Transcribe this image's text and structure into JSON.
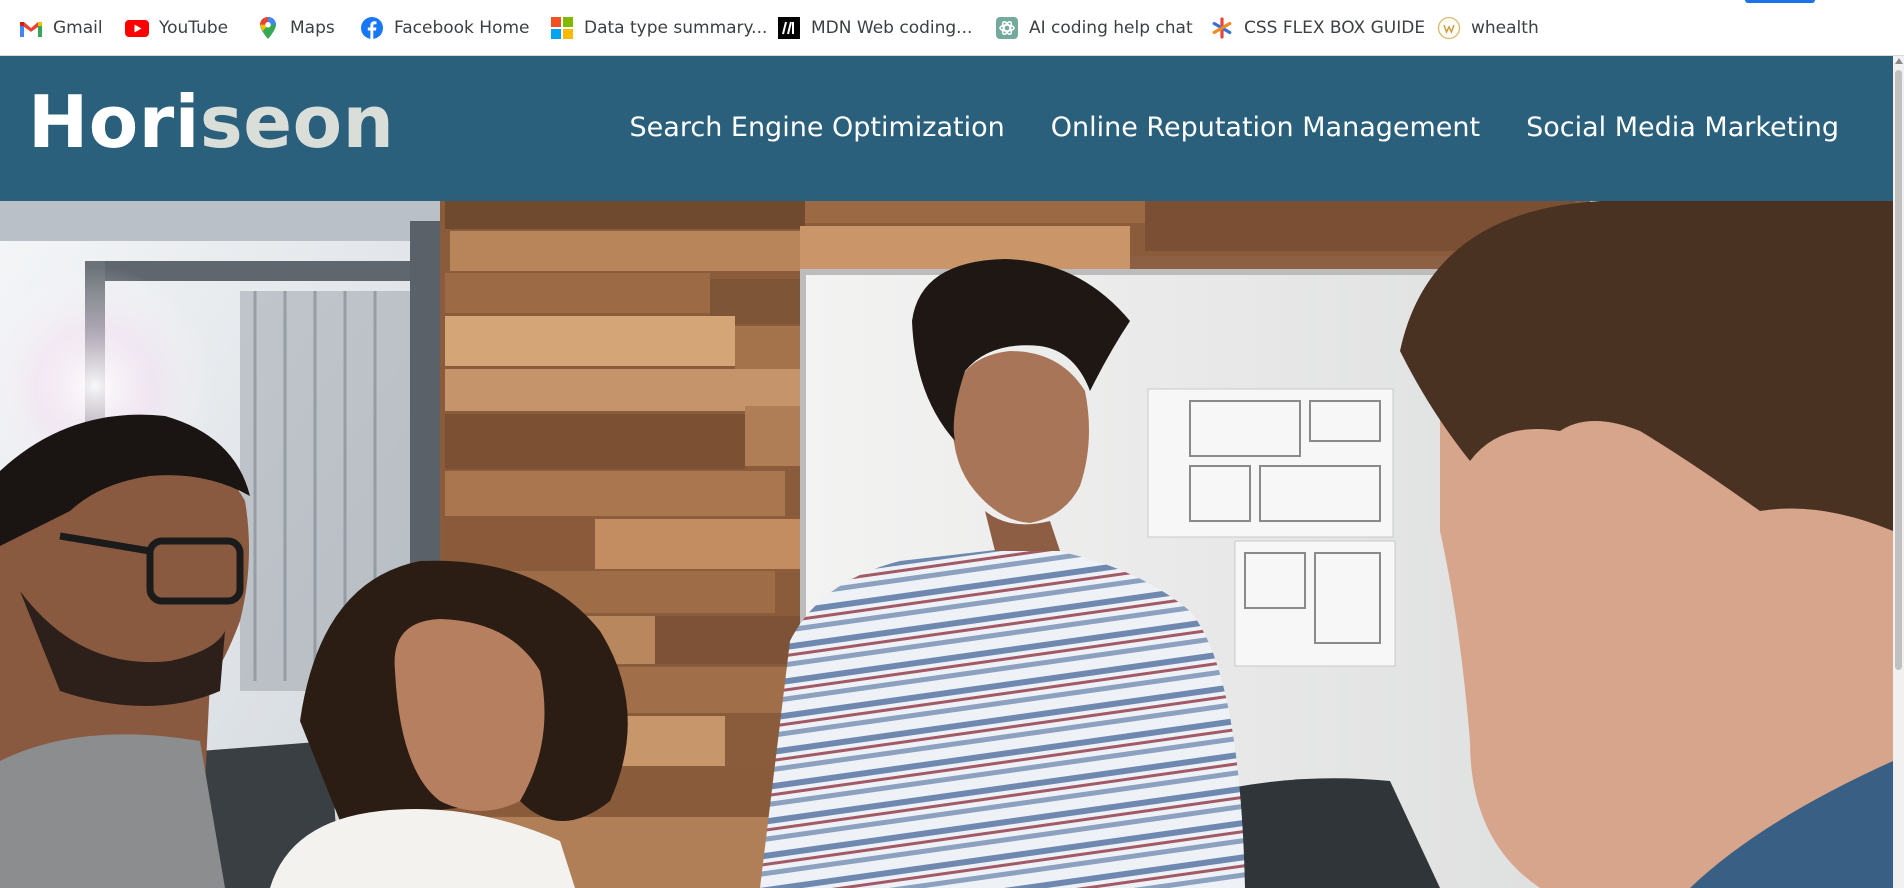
{
  "bookmarks": [
    {
      "label": "Gmail",
      "icon": "gmail-icon"
    },
    {
      "label": "YouTube",
      "icon": "youtube-icon"
    },
    {
      "label": "Maps",
      "icon": "maps-icon"
    },
    {
      "label": "Facebook Home",
      "icon": "facebook-icon"
    },
    {
      "label": "Data type summary...",
      "icon": "microsoft-icon"
    },
    {
      "label": "MDN Web coding...",
      "icon": "mdn-icon"
    },
    {
      "label": "AI coding help chat",
      "icon": "chatgpt-icon"
    },
    {
      "label": "CSS FLEX BOX GUIDE",
      "icon": "asterisk-icon"
    },
    {
      "label": "whealth",
      "icon": "whealth-icon"
    }
  ],
  "site": {
    "logo_main": "Hori",
    "logo_accent": "seon",
    "nav": [
      "Search Engine Optimization",
      "Online Reputation Management",
      "Social Media Marketing"
    ]
  },
  "colors": {
    "header_bg": "#2a607c",
    "logo_accent": "#d9ded9",
    "nav_text": "#ffffff"
  }
}
